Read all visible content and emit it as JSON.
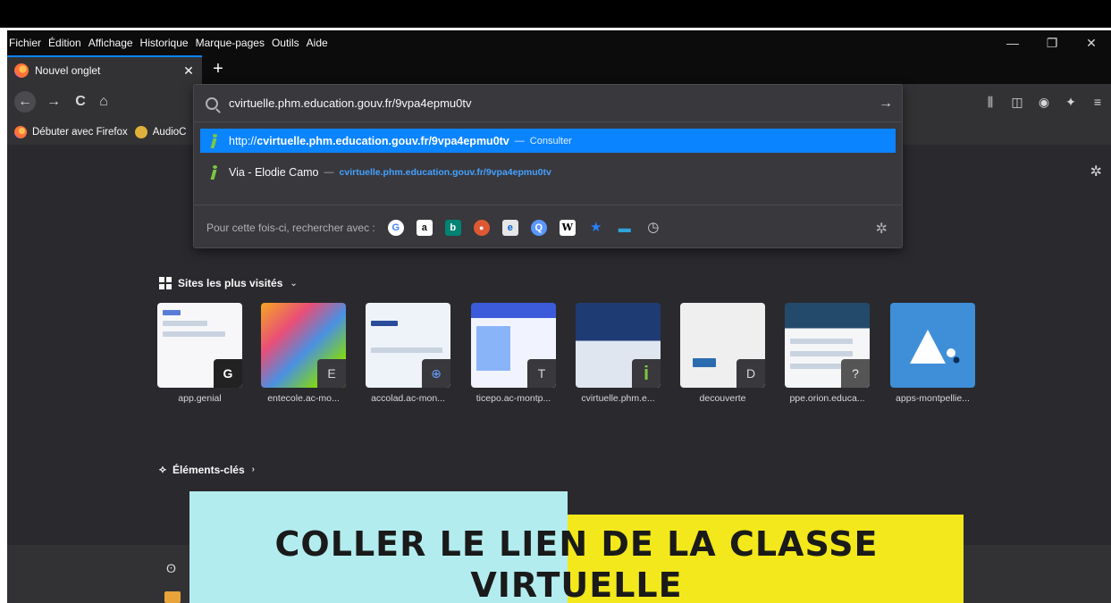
{
  "menubar": {
    "items": [
      "Fichier",
      "Édition",
      "Affichage",
      "Historique",
      "Marque-pages",
      "Outils",
      "Aide"
    ],
    "window_controls": [
      "—",
      "❐",
      "✕"
    ]
  },
  "tab": {
    "title": "Nouvel onglet",
    "close": "✕",
    "new_tab": "+"
  },
  "nav": {
    "back": "←",
    "forward": "→",
    "reload": "C",
    "home": "⌂",
    "right_icons": [
      "library-icon",
      "sidebar-icon",
      "account-icon",
      "extension-icon",
      "menu-icon"
    ]
  },
  "bookmarks": [
    {
      "label": "Débuter avec Firefox",
      "icon": "firefox-icon"
    },
    {
      "label": "AudioC",
      "icon": "audio-icon"
    }
  ],
  "urlbar": {
    "value": "cvirtuelle.phm.education.gouv.fr/9vpa4epmu0tv",
    "go": "→",
    "results": [
      {
        "prefix": "http://",
        "url_bold": "cvirtuelle.phm.education.gouv.fr/9vpa4epmu0tv",
        "sep": "—",
        "action": "Consulter"
      },
      {
        "title": "Via - Elodie Camo",
        "sep": "—",
        "url": "cvirtuelle.phm.education.gouv.fr/9vpa4epmu0tv"
      }
    ],
    "search_label": "Pour cette fois-ci, rechercher avec :",
    "engines": [
      {
        "name": "google",
        "glyph": "G",
        "color": "#ffffff",
        "text": "#4285f4"
      },
      {
        "name": "amazon",
        "glyph": "a",
        "color": "#ffffff",
        "text": "#111111"
      },
      {
        "name": "bing",
        "glyph": "b",
        "color": "#008373",
        "text": "#ffffff"
      },
      {
        "name": "duckduckgo",
        "glyph": "●",
        "color": "#de5833",
        "text": "#ffffff"
      },
      {
        "name": "ebay",
        "glyph": "e",
        "color": "#e6e6e6",
        "text": "#0064d2"
      },
      {
        "name": "qwant",
        "glyph": "Q",
        "color": "#5c97ff",
        "text": "#ffffff"
      },
      {
        "name": "wikipedia",
        "glyph": "W",
        "color": "#ffffff",
        "text": "#000000"
      },
      {
        "name": "star",
        "glyph": "★",
        "color": "transparent",
        "text": "#2a7fff"
      },
      {
        "name": "screen",
        "glyph": "▬",
        "color": "transparent",
        "text": "#2fa4d9"
      },
      {
        "name": "history",
        "glyph": "◷",
        "color": "transparent",
        "text": "#d7d7db"
      }
    ]
  },
  "topsites": {
    "heading": "Sites les plus visités",
    "sites": [
      {
        "label": "app.genial",
        "badge": "G"
      },
      {
        "label": "entecole.ac-mo...",
        "badge": "E"
      },
      {
        "label": "accolad.ac-mon...",
        "badge": "⊕"
      },
      {
        "label": "ticepo.ac-montp...",
        "badge": "T"
      },
      {
        "label": "cvirtuelle.phm.e...",
        "badge": "i"
      },
      {
        "label": "decouverte",
        "badge": "D"
      },
      {
        "label": "ppe.orion.educa...",
        "badge": "?"
      },
      {
        "label": "apps-montpellie...",
        "badge": ""
      }
    ]
  },
  "highlights": {
    "heading": "Éléments-clés"
  },
  "banner": {
    "line1": "COLLER LE LIEN DE LA CLASSE",
    "line2": "VIRTUELLE"
  }
}
